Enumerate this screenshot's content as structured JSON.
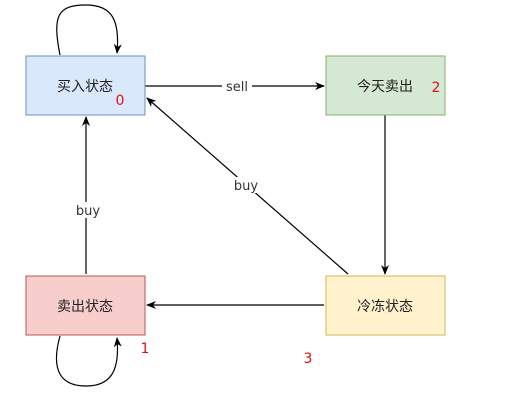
{
  "states": [
    {
      "id": "buy",
      "label": "买入状态",
      "tag": "0",
      "fill": "#dae8fc",
      "stroke": "#6c8ebf"
    },
    {
      "id": "sold",
      "label": "今天卖出",
      "tag": "2",
      "fill": "#d5e8d4",
      "stroke": "#82b366"
    },
    {
      "id": "cool",
      "label": "冷冻状态",
      "tag": "3",
      "fill": "#fff2cc",
      "stroke": "#d6b656"
    },
    {
      "id": "sell",
      "label": "卖出状态",
      "tag": "1",
      "fill": "#f8cecc",
      "stroke": "#b85450"
    }
  ],
  "edges": {
    "buy_to_sold": "sell",
    "cool_to_buy": "buy",
    "sell_to_buy": "buy"
  },
  "colors": {
    "arrow": "#000000",
    "tag": "#e01010"
  }
}
